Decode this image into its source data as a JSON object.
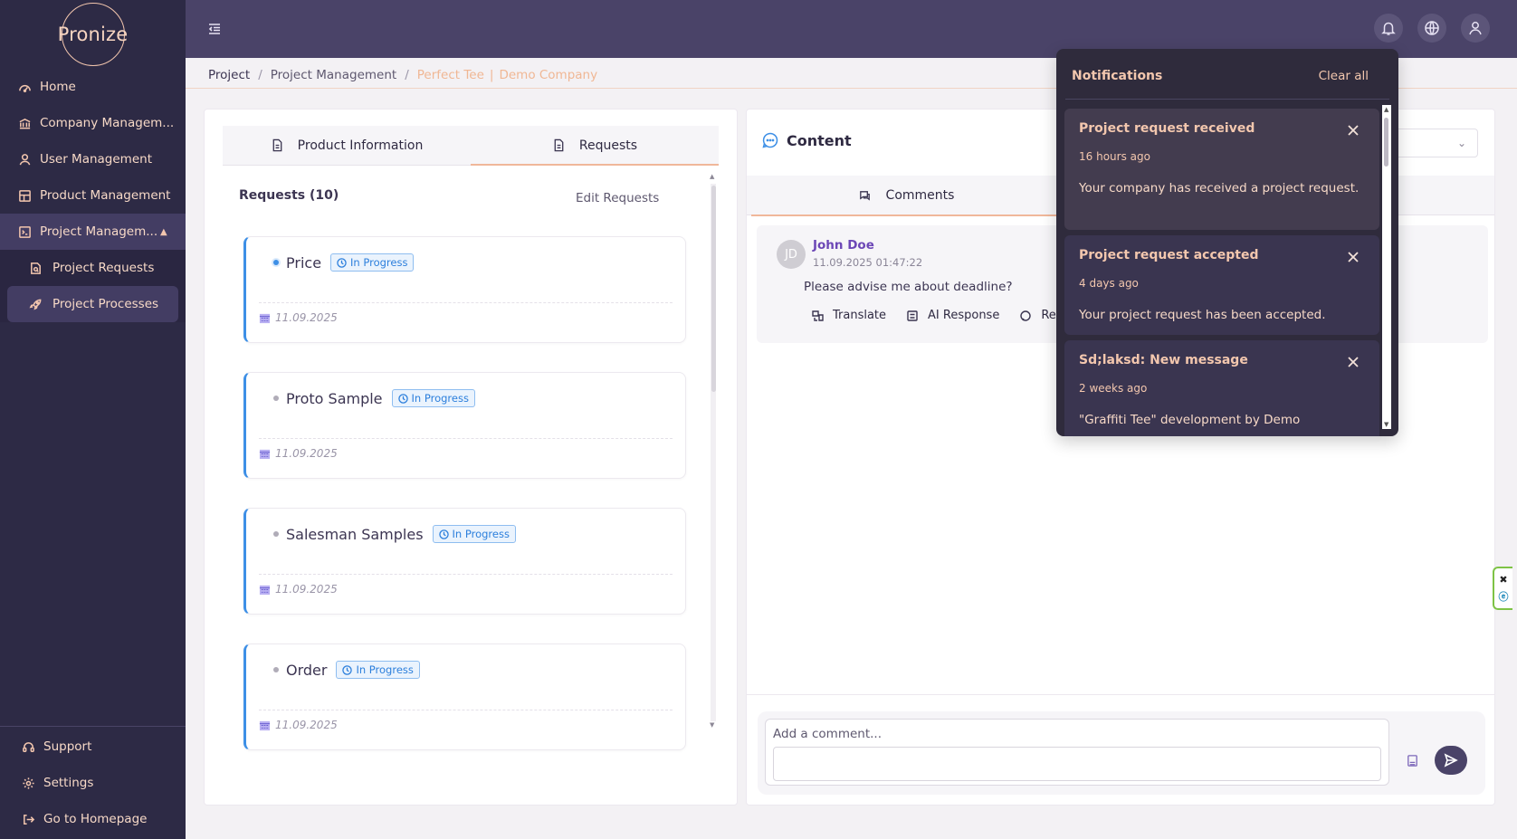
{
  "app": {
    "logo": "Pronize"
  },
  "sidebar": {
    "items": [
      {
        "label": "Home",
        "icon": "dashboard-icon"
      },
      {
        "label": "Company Managem...",
        "icon": "bank-icon"
      },
      {
        "label": "User Management",
        "icon": "user-icon"
      },
      {
        "label": "Product Management",
        "icon": "grid-icon"
      },
      {
        "label": "Project Managem...",
        "icon": "terminal-icon"
      }
    ],
    "subitems": [
      {
        "label": "Project Requests",
        "icon": "document-search-icon"
      },
      {
        "label": "Project Processes",
        "icon": "rocket-icon"
      }
    ],
    "bottom": [
      {
        "label": "Support",
        "icon": "headset-icon"
      },
      {
        "label": "Settings",
        "icon": "gear-icon"
      },
      {
        "label": "Go to Homepage",
        "icon": "logout-icon"
      }
    ]
  },
  "breadcrumb": {
    "project": "Project",
    "management": "Project Management",
    "product": "Perfect Tee",
    "divider": "|",
    "company": "Demo Company"
  },
  "left_panel": {
    "tabs": [
      {
        "label": "Product Information"
      },
      {
        "label": "Requests"
      }
    ],
    "requests_header": "Requests (10)",
    "edit_label": "Edit Requests",
    "requests": [
      {
        "name": "Price",
        "status": "In Progress",
        "date": "11.09.2025"
      },
      {
        "name": "Proto Sample",
        "status": "In Progress",
        "date": "11.09.2025"
      },
      {
        "name": "Salesman Samples",
        "status": "In Progress",
        "date": "11.09.2025"
      },
      {
        "name": "Order",
        "status": "In Progress",
        "date": "11.09.2025"
      }
    ]
  },
  "right_panel": {
    "title": "Content",
    "tab": "Comments",
    "comment": {
      "initials": "JD",
      "author": "John Doe",
      "time": "11.09.2025 01:47:22",
      "text": "Please advise me about deadline?",
      "actions": [
        "Translate",
        "AI Response",
        "Re"
      ]
    },
    "composer": {
      "placeholder": "Add a comment..."
    }
  },
  "notifications": {
    "title": "Notifications",
    "clear_label": "Clear all",
    "items": [
      {
        "title": "Project request received",
        "time": "16 hours ago",
        "body": "Your company has received a project request."
      },
      {
        "title": "Project request accepted",
        "time": "4 days ago",
        "body": "Your project request has been accepted."
      },
      {
        "title": "Sd;laksd: New message",
        "time": "2 weeks ago",
        "body": "\"Graffiti Tee\" development by Demo"
      }
    ]
  },
  "colors": {
    "sidebar_bg": "#2d2a45",
    "topbar_bg": "#4a4368",
    "accent_peach": "#f0b794",
    "status_blue": "#2c7fdc",
    "notification_bg": "#2f2b3c"
  }
}
